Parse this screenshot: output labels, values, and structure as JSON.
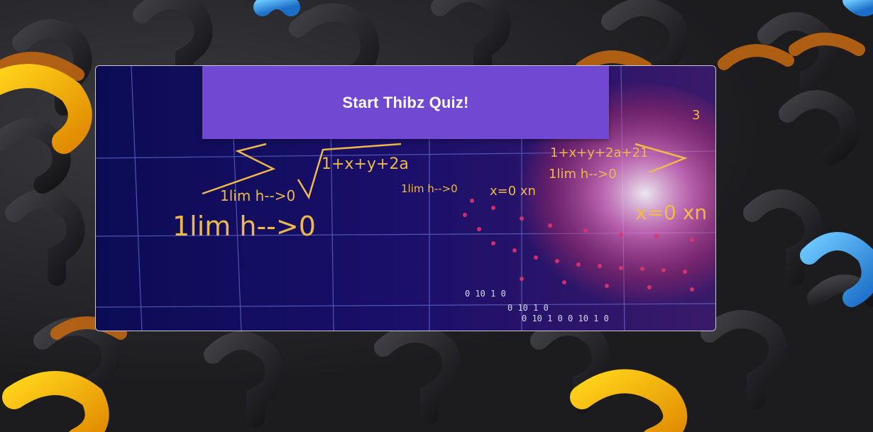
{
  "quiz": {
    "start_button_label": "Start Thibz Quiz!"
  },
  "hero_image": {
    "formula_texts": [
      "1lim h-->0",
      "1lim h-->0",
      "1+x+y+2a",
      "1+x+y+2a+21",
      "x=0 xn",
      "x=0 xn",
      "1lim h-->0",
      "1lim h-->0",
      "0 10 1 0",
      "0 10 1 0",
      "0 10 1 0 0 10 1 0",
      "3"
    ]
  },
  "colors": {
    "button_bg": "#7048d2",
    "button_text": "#ffffff",
    "card_bg": "#10105a",
    "formula": "#f0b84a",
    "pink": "#e0336e"
  }
}
